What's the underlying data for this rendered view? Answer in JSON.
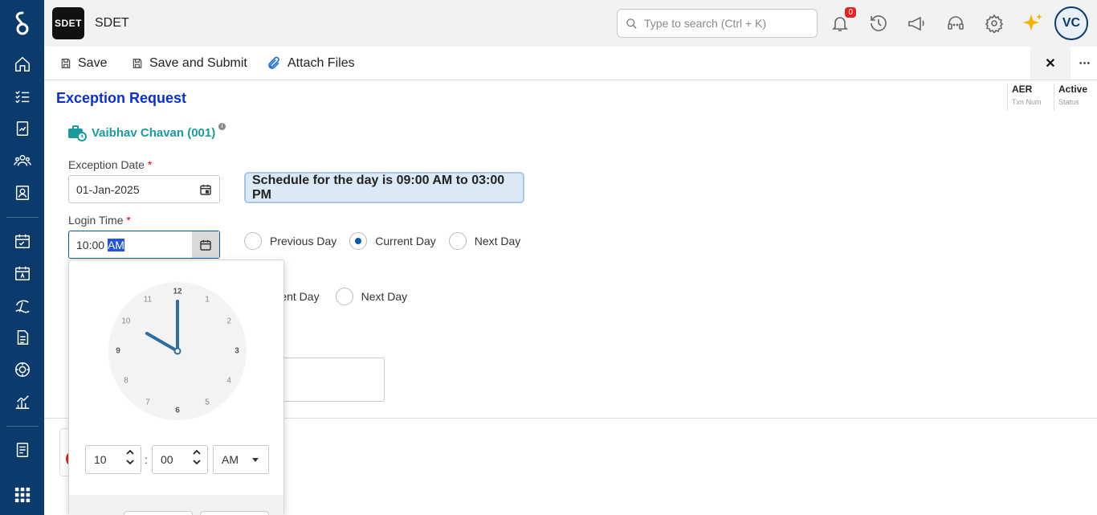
{
  "app": {
    "badge": "SDET",
    "name": "SDET"
  },
  "search": {
    "placeholder": "Type to search (Ctrl + K)"
  },
  "notifications": {
    "count": "0"
  },
  "user": {
    "initials": "VC"
  },
  "toolbar": {
    "save_label": "Save",
    "save_submit_label": "Save and Submit",
    "attach_label": "Attach Files",
    "close_label": "✕",
    "more_label": "•••"
  },
  "page": {
    "title": "Exception Request"
  },
  "meta": [
    {
      "value": "AER",
      "label": "Txn Num"
    },
    {
      "value": "Active",
      "label": "Status"
    }
  ],
  "employee": {
    "name": "Vaibhav Chavan (001)"
  },
  "form": {
    "exception_date_label": "Exception Date",
    "exception_date_value": "01-Jan-2025",
    "login_time_label": "Login Time",
    "login_time_hours": "10:00",
    "login_time_period": "AM",
    "required_mark": "*",
    "schedule_text": "Schedule for the day is 09:00 AM to 03:00 PM",
    "login_day_options": [
      {
        "label": "Previous Day",
        "checked": false
      },
      {
        "label": "Current Day",
        "checked": true
      },
      {
        "label": "Next Day",
        "checked": false
      }
    ],
    "logout_day_options": [
      {
        "label": "rrent Day",
        "checked": false
      },
      {
        "label": "Next Day",
        "checked": false
      }
    ]
  },
  "time_picker": {
    "hour": "10",
    "minute": "00",
    "period": "AM",
    "separator": ":",
    "clock_numbers": [
      "12",
      "1",
      "2",
      "3",
      "4",
      "5",
      "6",
      "7",
      "8",
      "9",
      "10",
      "11"
    ],
    "hand_hour": 10,
    "hand_minute": 0
  },
  "colors": {
    "sidebar": "#0b3a6d",
    "accent": "#0a2fd6",
    "employee": "#1a9b9b",
    "radio_checked": "#0b5aa6",
    "clock_hand": "#2e6da4"
  }
}
